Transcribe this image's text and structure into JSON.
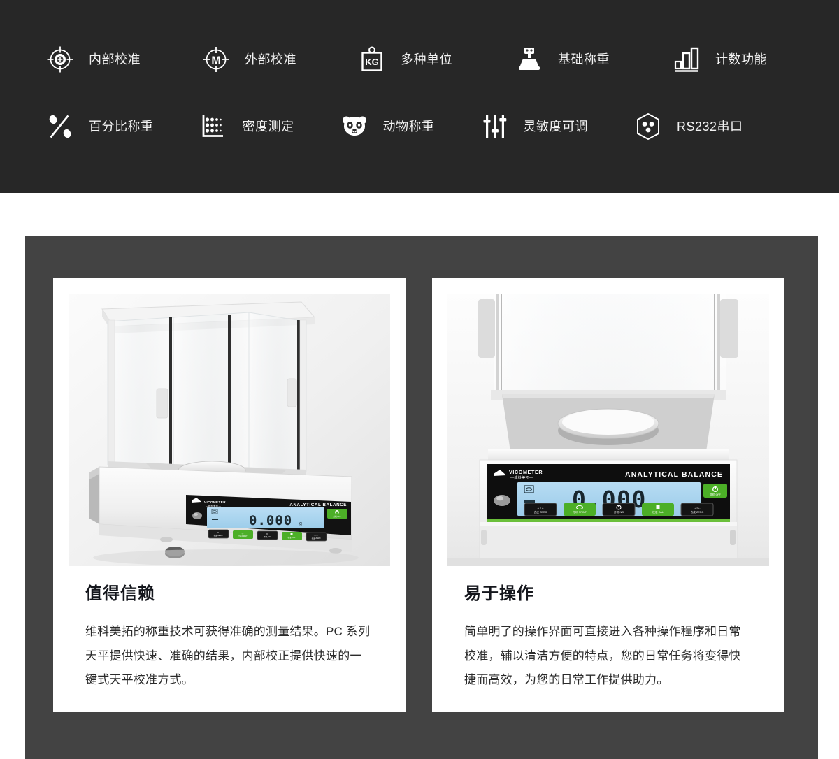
{
  "features": {
    "rows": [
      [
        {
          "icon": "crosshair-target-icon",
          "label": "内部校准"
        },
        {
          "icon": "crosshair-m-icon",
          "label": "外部校准"
        },
        {
          "icon": "kg-weight-icon",
          "label": "多种单位"
        },
        {
          "icon": "platform-scale-icon",
          "label": "基础称重"
        },
        {
          "icon": "bar-chart-icon",
          "label": "计数功能"
        }
      ],
      [
        {
          "icon": "percent-icon",
          "label": "百分比称重"
        },
        {
          "icon": "density-dots-icon",
          "label": "密度测定"
        },
        {
          "icon": "panda-animal-icon",
          "label": "动物称重"
        },
        {
          "icon": "sliders-icon",
          "label": "灵敏度可调"
        },
        {
          "icon": "hexagon-port-icon",
          "label": "RS232串口"
        }
      ]
    ]
  },
  "cards": [
    {
      "photo": "analytical-balance-full-view",
      "title": "值得信赖",
      "text": "维科美拓的称重技术可获得准确的测量结果。PC 系列天平提供快速、准确的结果，内部校正提供快速的一键式天平校准方式。",
      "device": {
        "brand": "VICOMETER",
        "brand_cn": "维科美拓",
        "model_text": "ANALYTICAL BALANCE",
        "display_value": "0.000",
        "display_unit": "g",
        "buttons": [
          "去皮 ZERO",
          "打印 PRINT",
          "开机 NO",
          "校准 CAL",
          "去皮 ZERO"
        ],
        "power_button": "关机 OFF"
      }
    },
    {
      "photo": "analytical-balance-closeup-view",
      "title": "易于操作",
      "text": "简单明了的操作界面可直接进入各种操作程序和日常校准，辅以清洁方便的特点，您的日常任务将变得快捷而高效，为您的日常工作提供助力。",
      "device": {
        "brand": "VICOMETER",
        "brand_cn": "维科美拓",
        "model_text": "ANALYTICAL BALANCE",
        "display_value": "0.000",
        "display_unit": "g",
        "buttons": [
          "去皮 ZERO",
          "打印 PRINT",
          "开机 NO",
          "校准 CAL",
          "去皮 ZERO"
        ],
        "power_button": "关机 OFF"
      }
    }
  ],
  "colors": {
    "top_band": "#272727",
    "panel": "#434343",
    "card_bg": "#ffffff",
    "photo_bg": "#f3f3f3",
    "lcd": "#a9d4ef",
    "key_green": "#4caf27",
    "title": "#14161c",
    "body_text": "#2b2b2b",
    "icon": "#ffffff"
  }
}
